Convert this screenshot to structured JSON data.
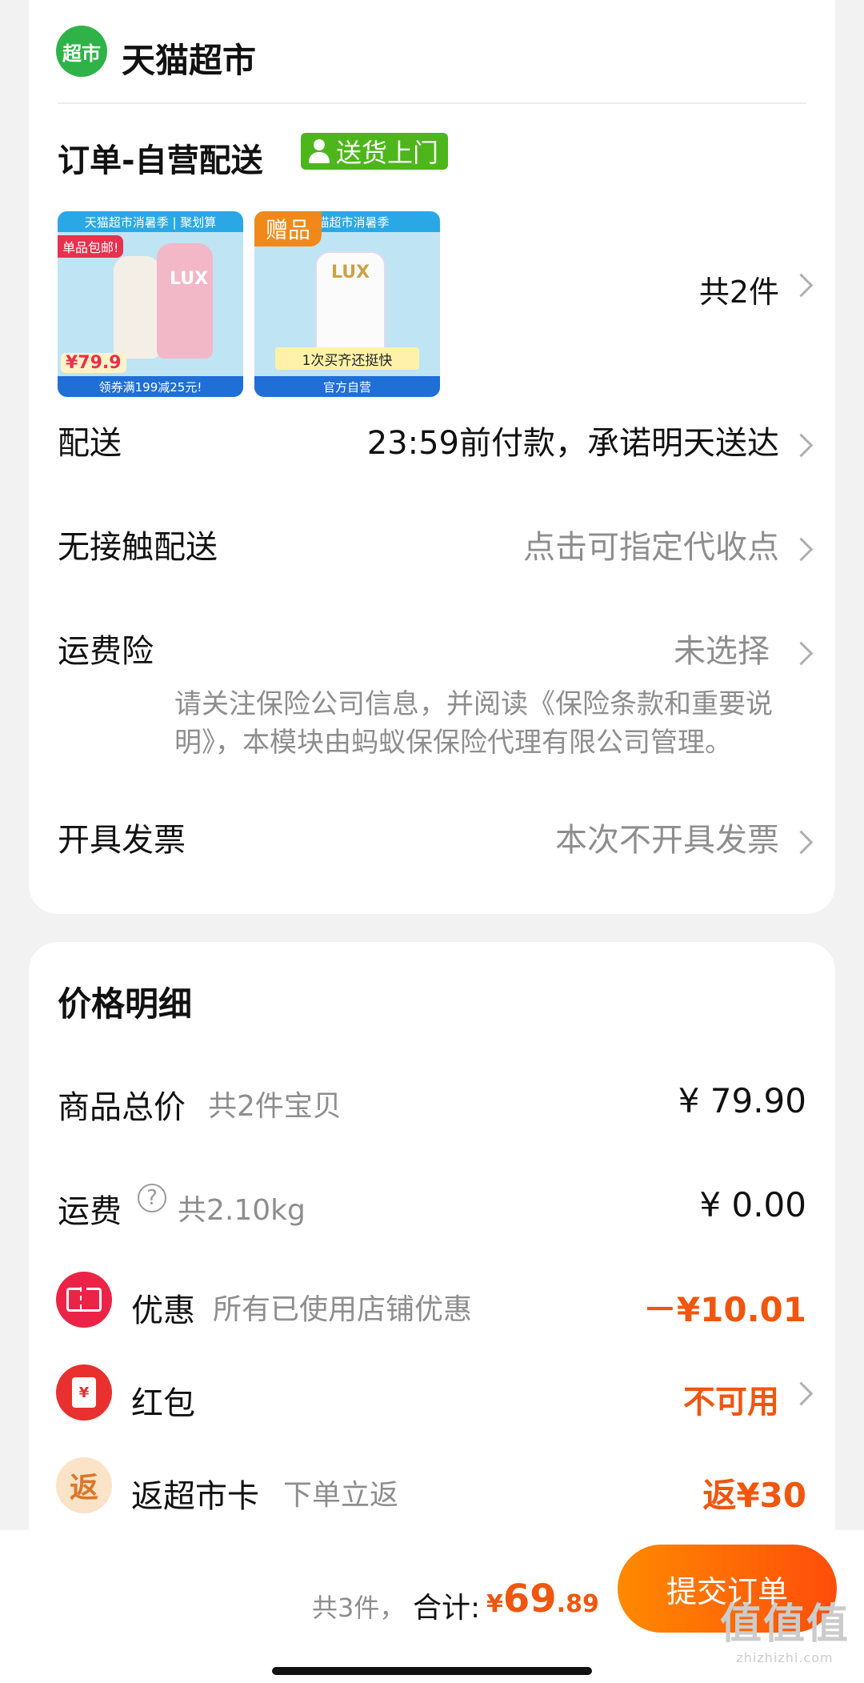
{
  "store": {
    "logo_text": "超市",
    "name": "天猫超市"
  },
  "order": {
    "title": "订单-自营配送",
    "badge": "送货上门",
    "count_text": "共2件",
    "products": [
      {
        "top_text": "天猫超市消暑季 | 聚划算",
        "tag": "单品包邮!",
        "brand": "LUX",
        "price": "¥79.9",
        "banner": "领券满199减25元!"
      },
      {
        "top_text": "天猫超市消暑季",
        "gift": "赠品",
        "brand": "LUX",
        "strip": "1次买齐还挺快",
        "banner": "官方自营"
      }
    ]
  },
  "rows": {
    "delivery": {
      "label": "配送",
      "value": "23:59前付款，承诺明天送达"
    },
    "contactless": {
      "label": "无接触配送",
      "value": "点击可指定代收点"
    },
    "insurance": {
      "label": "运费险",
      "value": "未选择",
      "note": "请关注保险公司信息，并阅读《保险条款和重要说明》，本模块由蚂蚁保保险代理有限公司管理。"
    },
    "invoice": {
      "label": "开具发票",
      "value": "本次不开具发票"
    }
  },
  "price": {
    "title": "价格明细",
    "goods": {
      "label": "商品总价",
      "sub": "共2件宝贝",
      "value": "¥ 79.90"
    },
    "shipping": {
      "label": "运费",
      "help": "?",
      "sub": "共2.10kg",
      "value": "¥ 0.00"
    },
    "discount": {
      "label": "优惠",
      "sub": "所有已使用店铺优惠",
      "value": "－¥10.01"
    },
    "redpacket": {
      "label": "红包",
      "icon_text": "¥",
      "value": "不可用"
    },
    "cashback": {
      "icon_text": "返",
      "label": "返超市卡",
      "sub": "下单立返",
      "value": "返¥30"
    }
  },
  "footer": {
    "count": "共3件，",
    "label": "合计:",
    "currency": "¥",
    "amount_int": "69",
    "amount_dec": ".89",
    "submit": "提交订单",
    "watermark": "值值值",
    "watermark_url": "zhizhizhi.com"
  },
  "colors": {
    "accent": "#f0560e",
    "store_green": "#2fb349",
    "badge_green": "#4cb61b",
    "submit_start": "#ff8a00",
    "submit_end": "#ff4d0a"
  }
}
